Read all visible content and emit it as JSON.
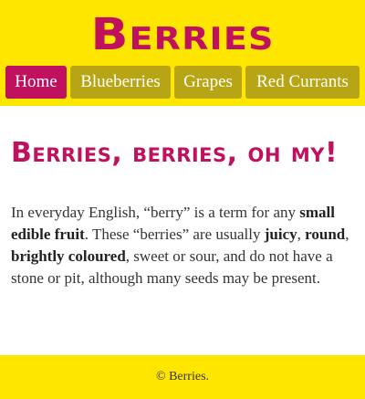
{
  "header": {
    "site_title": "Berries"
  },
  "nav": {
    "items": [
      {
        "label": "Home",
        "active": true
      },
      {
        "label": "Blueberries",
        "active": false
      },
      {
        "label": "Grapes",
        "active": false
      },
      {
        "label": "Red Currants",
        "active": false
      }
    ]
  },
  "main": {
    "heading": "Berries, berries, oh my!",
    "paragraph": {
      "p1": "In everyday English, “berry” is a term for any ",
      "b1": "small edible fruit",
      "p2": ". These “berries” are usually ",
      "b2": "juicy",
      "p3": ", ",
      "b3": "round",
      "p4": ", ",
      "b4": "brightly coloured",
      "p5": ", sweet or sour, and do not have a stone or pit, although many seeds may be present."
    }
  },
  "footer": {
    "text": "© Berries."
  },
  "colors": {
    "header_bg": "#ffe600",
    "accent": "#c0115e",
    "nav_bg": "#b8a516"
  }
}
